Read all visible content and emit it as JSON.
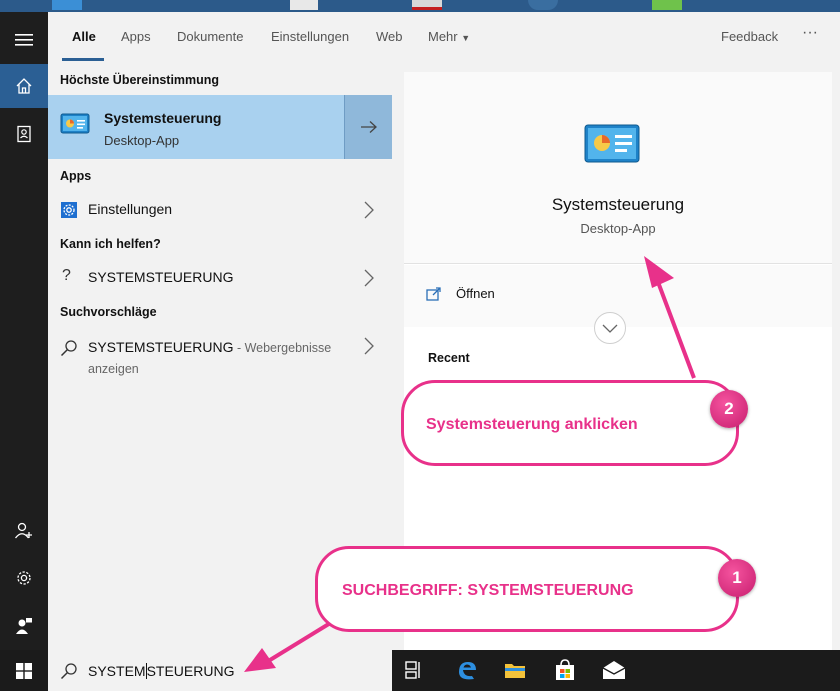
{
  "tabs": [
    {
      "label": "Alle",
      "active": true
    },
    {
      "label": "Apps"
    },
    {
      "label": "Dokumente"
    },
    {
      "label": "Einstellungen"
    },
    {
      "label": "Web"
    },
    {
      "label": "Mehr"
    }
  ],
  "header_right": {
    "feedback": "Feedback",
    "more": "···"
  },
  "best_match": {
    "heading": "Höchste Übereinstimmung",
    "title": "Systemsteuerung",
    "subtitle": "Desktop-App"
  },
  "apps": {
    "heading": "Apps",
    "item": "Einstellungen"
  },
  "help": {
    "heading": "Kann ich helfen?",
    "item": "SYSTEMSTEUERUNG"
  },
  "suggestions": {
    "heading": "Suchvorschläge",
    "item": "SYSTEMSTEUERUNG",
    "suffix": " - Webergebnisse",
    "suffix2": "anzeigen"
  },
  "preview": {
    "title": "Systemsteuerung",
    "subtitle": "Desktop-App",
    "open": "Öffnen",
    "recent": "Recent"
  },
  "search": {
    "before_caret": "SYSTEM",
    "after_caret": "STEUERUNG"
  },
  "callouts": {
    "one": {
      "number": "1",
      "text": "SUCHBEGRIFF: SYSTEMSTEUERUNG"
    },
    "two": {
      "number": "2",
      "text": "Systemsteuerung anklicken"
    }
  },
  "colors": {
    "accent": "#2b5f94",
    "highlight": "#a9d1ef",
    "annotation": "#e8318a"
  }
}
